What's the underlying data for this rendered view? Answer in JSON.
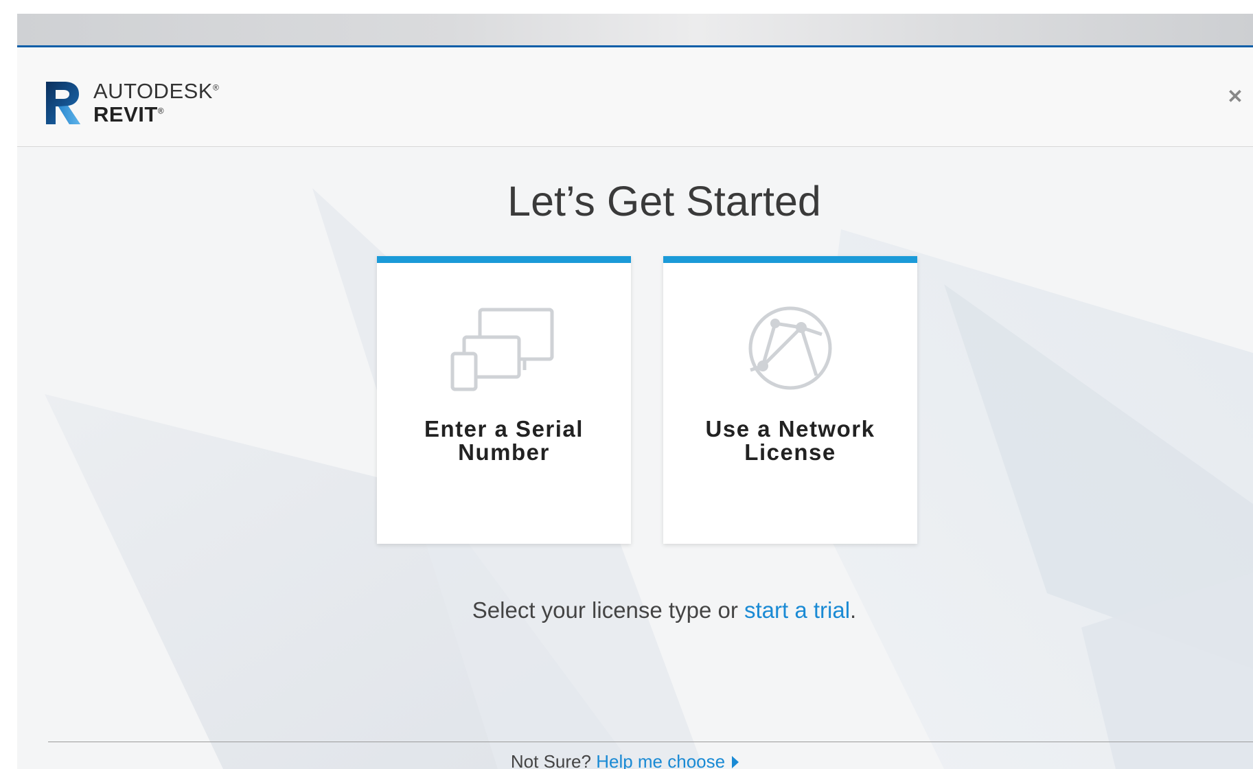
{
  "brand": {
    "company": "AUTODESK",
    "product": "REVIT",
    "reg_mark": "®"
  },
  "window": {
    "close_glyph": "✕"
  },
  "main": {
    "heading": "Let’s Get Started",
    "cards": [
      {
        "line1": "Enter a Serial",
        "line2": "Number",
        "icon": "devices-icon"
      },
      {
        "line1": "Use a Network",
        "line2": "License",
        "icon": "network-globe-icon"
      }
    ],
    "prompt_text": "Select your license type or ",
    "trial_link": "start a trial",
    "prompt_end": "."
  },
  "footer": {
    "question": "Not Sure? ",
    "help_link": "Help me choose"
  },
  "colors": {
    "accent": "#1b9ad8",
    "link": "#1a8ad4",
    "titlebar_border": "#0b5ea8"
  }
}
